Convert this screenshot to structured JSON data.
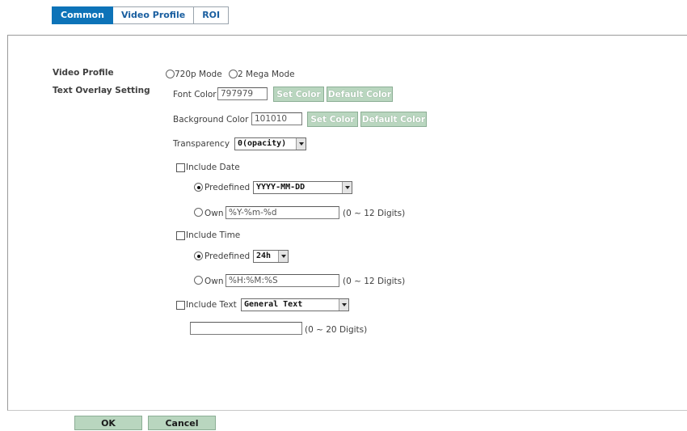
{
  "tabs": {
    "common": "Common",
    "video_profile": "Video Profile",
    "roi": "ROI"
  },
  "video_profile": {
    "label": "Video Profile",
    "option_720p": "720p Mode",
    "option_2mega": "2 Mega Mode",
    "selected": "none"
  },
  "text_overlay": {
    "label": "Text Overlay Setting",
    "font_color_label": "Font Color",
    "font_color_value": "797979",
    "background_color_label": "Background Color",
    "background_color_value": "101010",
    "set_color": "Set Color",
    "default_color": "Default Color",
    "transparency_label": "Transparency",
    "transparency_value": "0(opacity)"
  },
  "date": {
    "include_label": "Include Date",
    "predefined_label": "Predefined",
    "predefined_value": "YYYY-MM-DD",
    "own_label": "Own",
    "own_value": "%Y-%m-%d",
    "own_hint": "(0 ~ 12 Digits)"
  },
  "time": {
    "include_label": "Include Time",
    "predefined_label": "Predefined",
    "predefined_value": "24h",
    "own_label": "Own",
    "own_value": "%H:%M:%S",
    "own_hint": "(0 ~ 12 Digits)"
  },
  "text": {
    "include_label": "Include Text",
    "type_value": "General Text",
    "custom_value": "",
    "hint": "(0 ~ 20 Digits)"
  },
  "actions": {
    "ok": "OK",
    "cancel": "Cancel"
  },
  "colors": {
    "tab_active_bg": "#0d73b8",
    "tab_text": "#1a5fa0",
    "button_bg": "#b9d6bf"
  }
}
